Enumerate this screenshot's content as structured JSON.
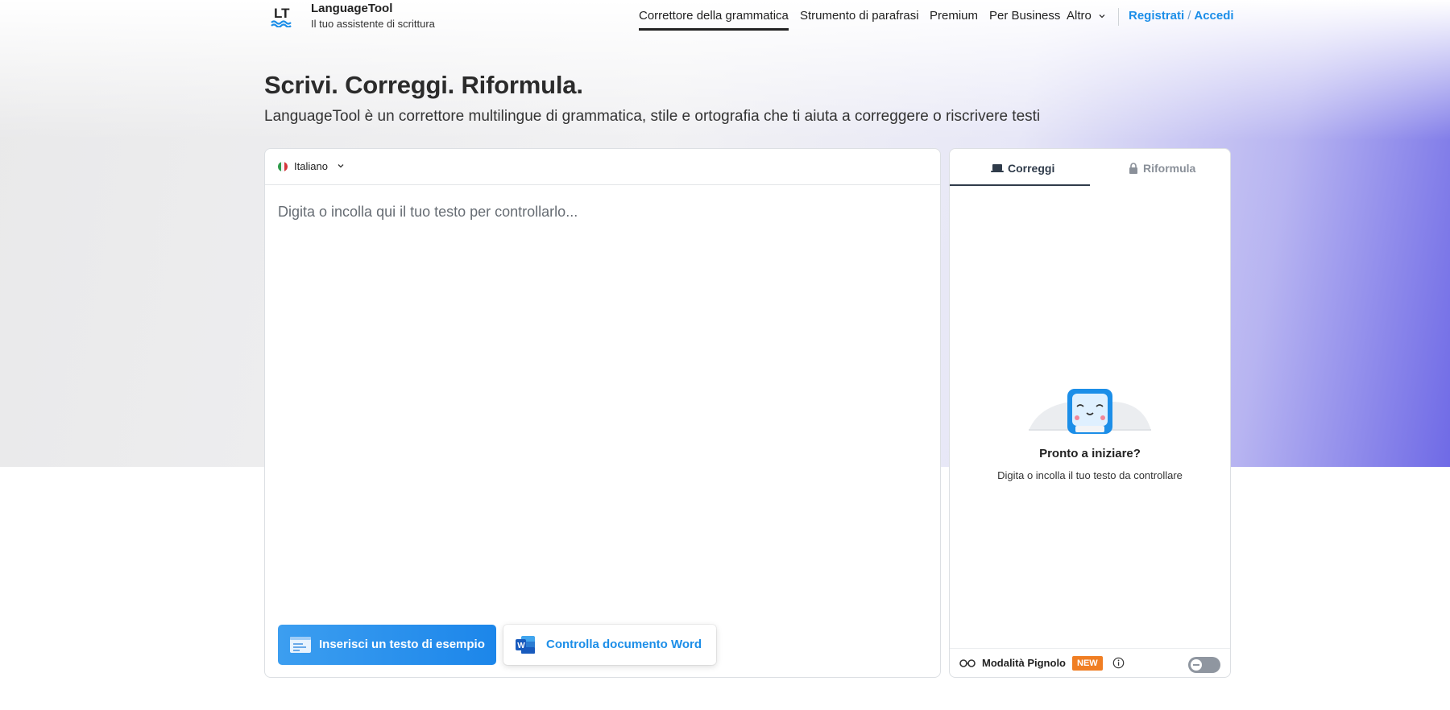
{
  "header": {
    "brand_name": "LanguageTool",
    "brand_tagline": "Il tuo assistente di scrittura",
    "nav": {
      "grammar_checker": "Correttore della grammatica",
      "paraphrase_tool": "Strumento di parafrasi",
      "premium": "Premium",
      "business": "Per Business",
      "more": "Altro"
    },
    "signup": "Registrati",
    "separator": "/",
    "login": "Accedi"
  },
  "hero": {
    "title": "Scrivi. Correggi. Riformula.",
    "subtitle": "LanguageTool è un correttore multilingue di grammatica, stile e ortografia che ti aiuta a correggere o riscrivere testi"
  },
  "editor": {
    "language": "Italiano",
    "placeholder": "Digita o incolla qui il tuo testo per controllarlo...",
    "sample_button": "Inserisci un testo di esempio",
    "word_button": "Controlla documento Word"
  },
  "side_panel": {
    "tab_correct": "Correggi",
    "tab_rephrase": "Riformula",
    "active_tab": "Correggi",
    "ready_title": "Pronto a iniziare?",
    "ready_subtitle": "Digita o incolla il tuo testo da controllare",
    "picky_mode_label": "Modalità Pignolo",
    "new_badge": "NEW",
    "picky_mode_enabled": false
  },
  "colors": {
    "accent": "#1c8ee8",
    "badge": "#f07e23",
    "gradient_end": "#6f6ae6"
  },
  "icons": {
    "logo": "lt-logo-icon",
    "language_flag": "italy-flag-icon",
    "sample": "document-sample-icon",
    "word": "word-doc-icon",
    "correct_tab": "laptop-icon",
    "rephrase_tab": "lock-icon",
    "picky": "glasses-icon",
    "info": "info-icon"
  }
}
